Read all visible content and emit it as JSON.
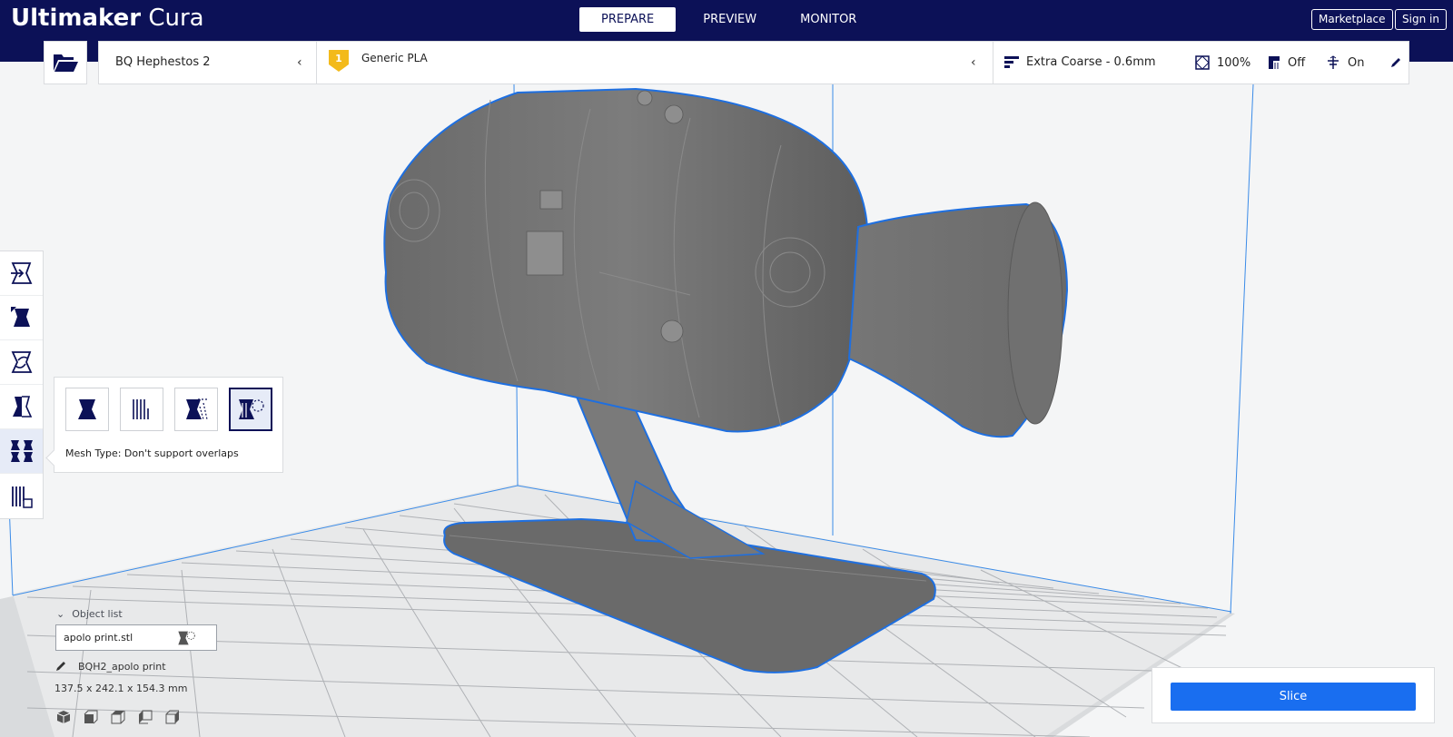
{
  "app": {
    "brand_bold": "Ultimaker",
    "brand_light": " Cura"
  },
  "stages": [
    {
      "label": "PREPARE",
      "active": true
    },
    {
      "label": "PREVIEW",
      "active": false
    },
    {
      "label": "MONITOR",
      "active": false
    }
  ],
  "header_buttons": {
    "marketplace": "Marketplace",
    "sign_in": "Sign in"
  },
  "printer": {
    "name": "BQ Hephestos 2"
  },
  "material": {
    "extruder_number": "1",
    "name": "Generic PLA",
    "badge_color": "#f3ba1b"
  },
  "print_setup": {
    "profile": "Extra Coarse - 0.6mm",
    "infill": "100%",
    "support": "Off",
    "adhesion": "On"
  },
  "tool_panel": {
    "label": "Mesh Type: Don't support overlaps",
    "mesh_types": [
      "normal-model",
      "print-as-support",
      "modify-overlaps",
      "dont-support-overlaps"
    ],
    "selected": "dont-support-overlaps"
  },
  "tools": [
    "move-tool-icon",
    "scale-tool-icon",
    "rotate-tool-icon",
    "mirror-tool-icon",
    "per-model-settings-icon",
    "support-blocker-icon"
  ],
  "object_list": {
    "toggle_label": "Object list",
    "item": "apolo print.stl",
    "job_name": "BQH2_apolo print",
    "dimensions": "137.5 x 242.1 x 154.3 mm"
  },
  "slice": {
    "label": "Slice"
  },
  "colors": {
    "header": "#0c1157",
    "accent": "#196ef0",
    "outline": "#1e6fe0"
  }
}
